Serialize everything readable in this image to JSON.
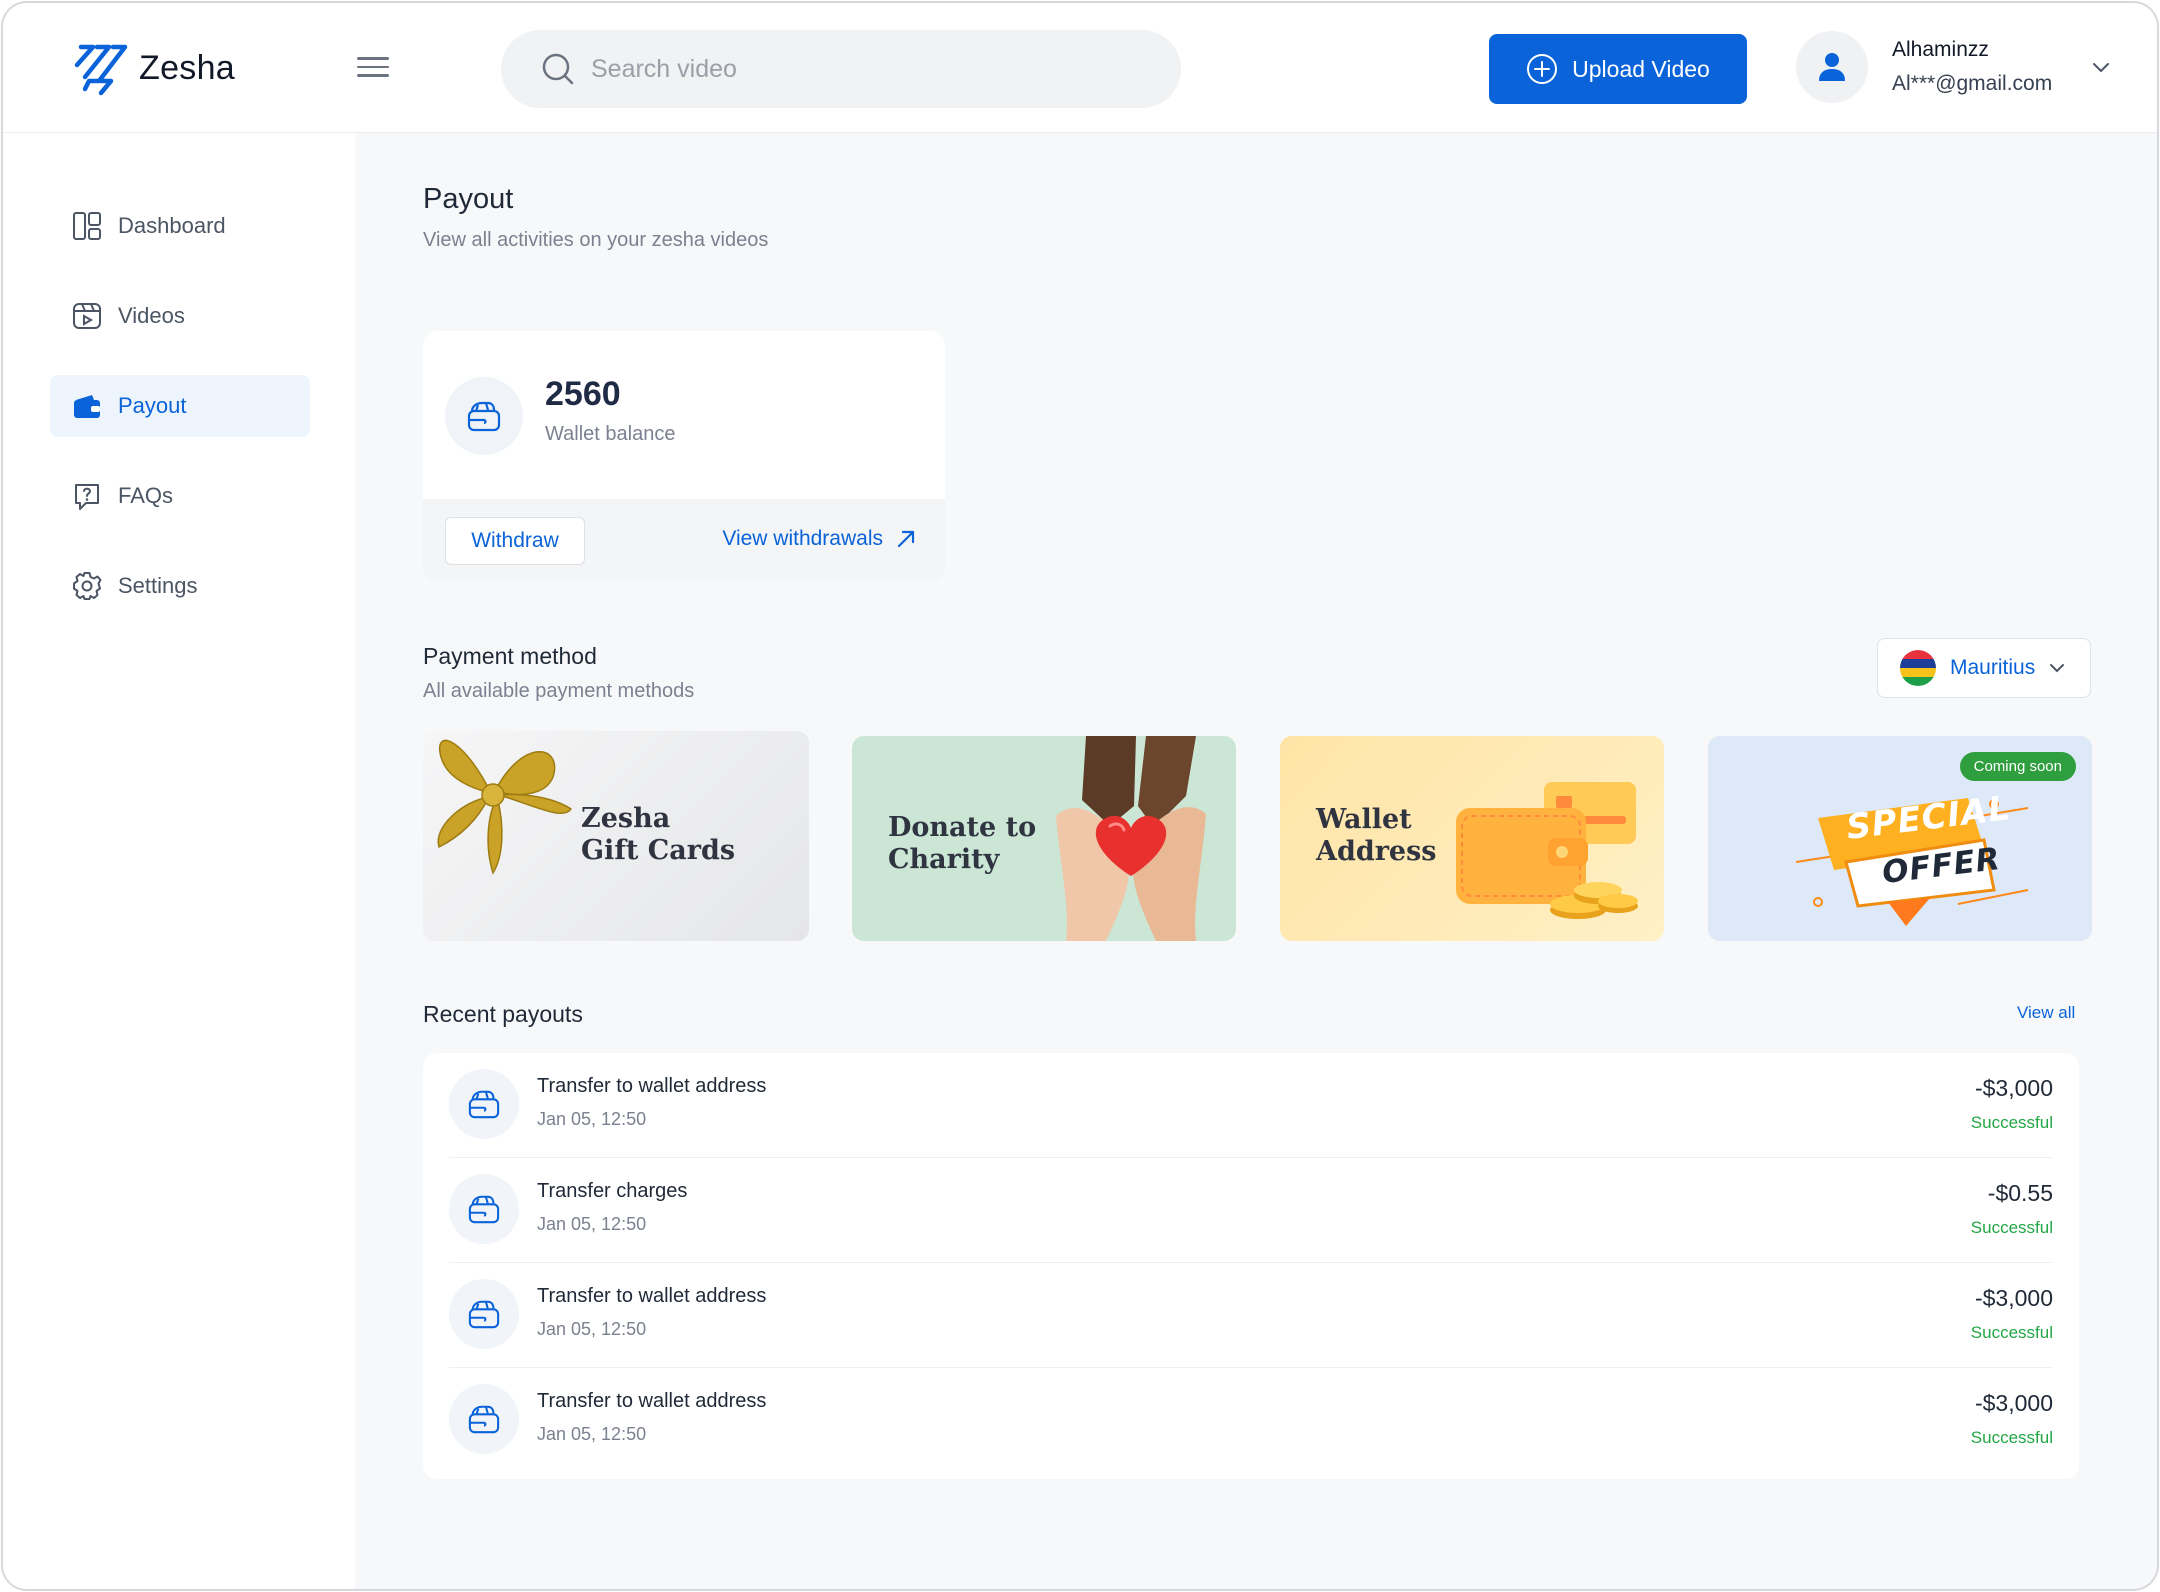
{
  "brand": {
    "name": "Zesha",
    "accent": "#0a63d8"
  },
  "search": {
    "placeholder": "Search video"
  },
  "header": {
    "upload_label": "Upload Video"
  },
  "user": {
    "name": "Alhaminzz",
    "email": "Al***@gmail.com"
  },
  "sidebar": {
    "items": [
      {
        "label": "Dashboard",
        "icon": "dashboard-icon"
      },
      {
        "label": "Videos",
        "icon": "video-icon"
      },
      {
        "label": "Payout",
        "icon": "wallet-icon",
        "active": true
      },
      {
        "label": "FAQs",
        "icon": "question-icon"
      },
      {
        "label": "Settings",
        "icon": "gear-icon"
      }
    ]
  },
  "page": {
    "title": "Payout",
    "subtitle": "View all activities on your zesha videos"
  },
  "wallet": {
    "amount": "2560",
    "label": "Wallet balance",
    "withdraw_label": "Withdraw",
    "view_withdrawals_label": "View withdrawals"
  },
  "payment_methods": {
    "title": "Payment method",
    "subtitle": "All available payment methods",
    "country": "Mauritius",
    "cards": [
      {
        "line1": "Zesha",
        "line2": "Gift Cards"
      },
      {
        "line1": "Donate to",
        "line2": "Charity"
      },
      {
        "line1": "Wallet",
        "line2": "Address"
      },
      {
        "badge": "Coming soon",
        "line1": "SPECIAL",
        "line2": "OFFER"
      }
    ]
  },
  "recent_payouts": {
    "title": "Recent payouts",
    "view_all_label": "View all",
    "rows": [
      {
        "name": "Transfer to wallet address",
        "date": "Jan 05,  12:50",
        "amount": "-$3,000",
        "status": "Successful"
      },
      {
        "name": "Transfer charges",
        "date": "Jan 05,  12:50",
        "amount": "-$0.55",
        "status": "Successful"
      },
      {
        "name": "Transfer to wallet address",
        "date": "Jan 05,  12:50",
        "amount": "-$3,000",
        "status": "Successful"
      },
      {
        "name": "Transfer to wallet address",
        "date": "Jan 05,  12:50",
        "amount": "-$3,000",
        "status": "Successful"
      }
    ]
  }
}
